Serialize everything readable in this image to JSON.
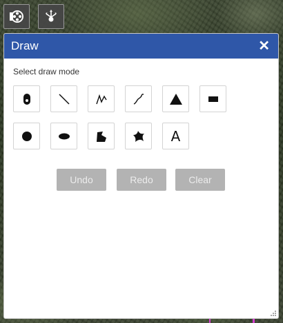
{
  "toolbar": {
    "items": [
      {
        "name": "layers-tool-button",
        "icon": "layer-list-icon"
      },
      {
        "name": "share-tool-button",
        "icon": "network-share-icon"
      }
    ]
  },
  "panel": {
    "title": "Draw",
    "close_icon": "close-icon",
    "mode_label": "Select draw mode",
    "modes": [
      {
        "icon": "point-icon"
      },
      {
        "icon": "line-icon"
      },
      {
        "icon": "polyline-icon"
      },
      {
        "icon": "freehand-polyline-icon"
      },
      {
        "icon": "triangle-icon"
      },
      {
        "icon": "rectangle-icon"
      },
      {
        "icon": "circle-icon"
      },
      {
        "icon": "ellipse-icon"
      },
      {
        "icon": "polygon-icon"
      },
      {
        "icon": "freehand-polygon-icon"
      },
      {
        "icon": "text-icon",
        "label": "A"
      }
    ],
    "actions": {
      "undo": "Undo",
      "redo": "Redo",
      "clear": "Clear"
    }
  },
  "colors": {
    "header": "#2f57a8",
    "disabled_button": "#b3b3b3",
    "map_line": "#d43fd0"
  }
}
